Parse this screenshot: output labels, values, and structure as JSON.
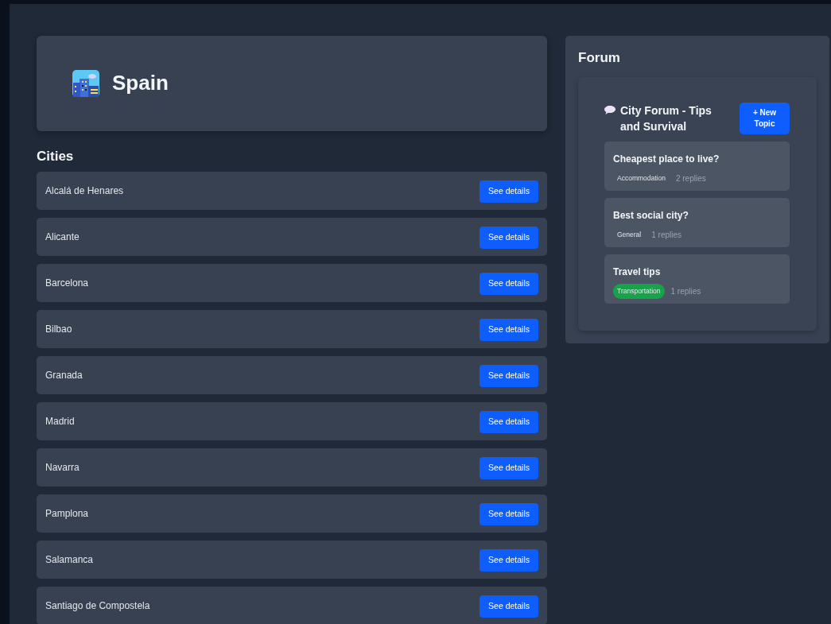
{
  "country": {
    "name": "Spain"
  },
  "cities_heading": "Cities",
  "cities": [
    {
      "name": "Alcalá de Henares",
      "button": "See details"
    },
    {
      "name": "Alicante",
      "button": "See details"
    },
    {
      "name": "Barcelona",
      "button": "See details"
    },
    {
      "name": "Bilbao",
      "button": "See details"
    },
    {
      "name": "Granada",
      "button": "See details"
    },
    {
      "name": "Madrid",
      "button": "See details"
    },
    {
      "name": "Navarra",
      "button": "See details"
    },
    {
      "name": "Pamplona",
      "button": "See details"
    },
    {
      "name": "Salamanca",
      "button": "See details"
    },
    {
      "name": "Santiago de Compostela",
      "button": "See details"
    }
  ],
  "forum": {
    "heading": "Forum",
    "title": "City Forum - Tips and Survival",
    "new_topic_button": "+ New Topic",
    "topics": [
      {
        "title": "Cheapest place to live?",
        "tag": "Accommodation",
        "color": "#4b5563",
        "replies": "2 replies"
      },
      {
        "title": "Best social city?",
        "tag": "General",
        "color": "#4b5563",
        "replies": "1 replies"
      },
      {
        "title": "Travel tips",
        "tag": "Transportation",
        "color": "#16a34a",
        "replies": "1 replies"
      }
    ]
  }
}
